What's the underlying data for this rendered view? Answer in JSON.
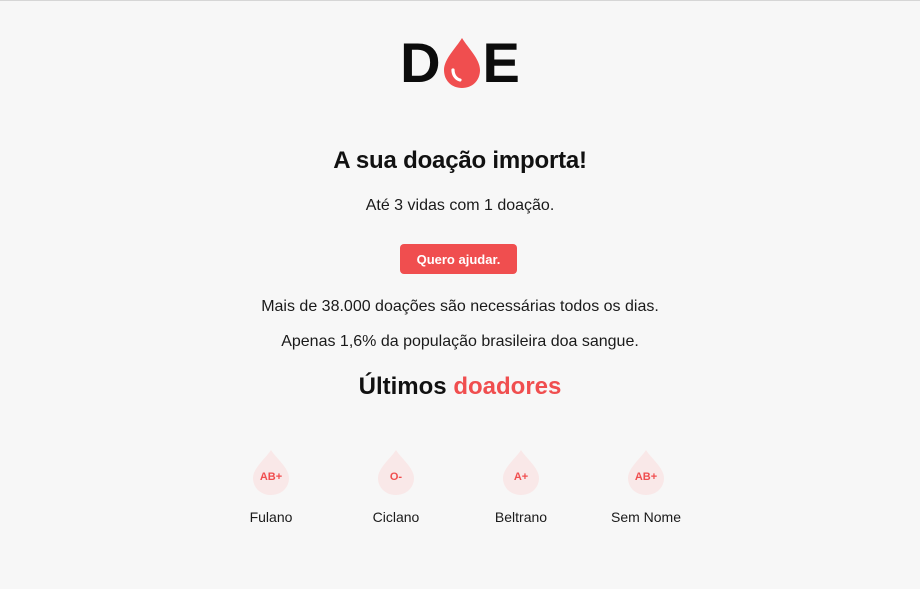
{
  "brand": {
    "letters": [
      "D",
      "E"
    ],
    "accent_color": "#f04e4f",
    "logo_icon": "blood-drop-icon"
  },
  "hero": {
    "headline": "A sua doação importa!",
    "subheadline": "Até 3 vidas com 1 doação.",
    "cta_label": "Quero ajudar."
  },
  "stats": [
    "Mais de 38.000 doações são necessárias todos os dias.",
    "Apenas 1,6% da população brasileira doa sangue."
  ],
  "donors_section": {
    "title_plain": "Últimos",
    "title_accent": "doadores",
    "donors": [
      {
        "name": "Fulano",
        "blood_type": "AB+"
      },
      {
        "name": "Ciclano",
        "blood_type": "O-"
      },
      {
        "name": "Beltrano",
        "blood_type": "A+"
      },
      {
        "name": "Sem Nome",
        "blood_type": "AB+"
      }
    ]
  },
  "colors": {
    "background": "#f7f7f7",
    "text": "#111111",
    "accent": "#f04e4f",
    "drop_pale": "#f9e8e8"
  }
}
